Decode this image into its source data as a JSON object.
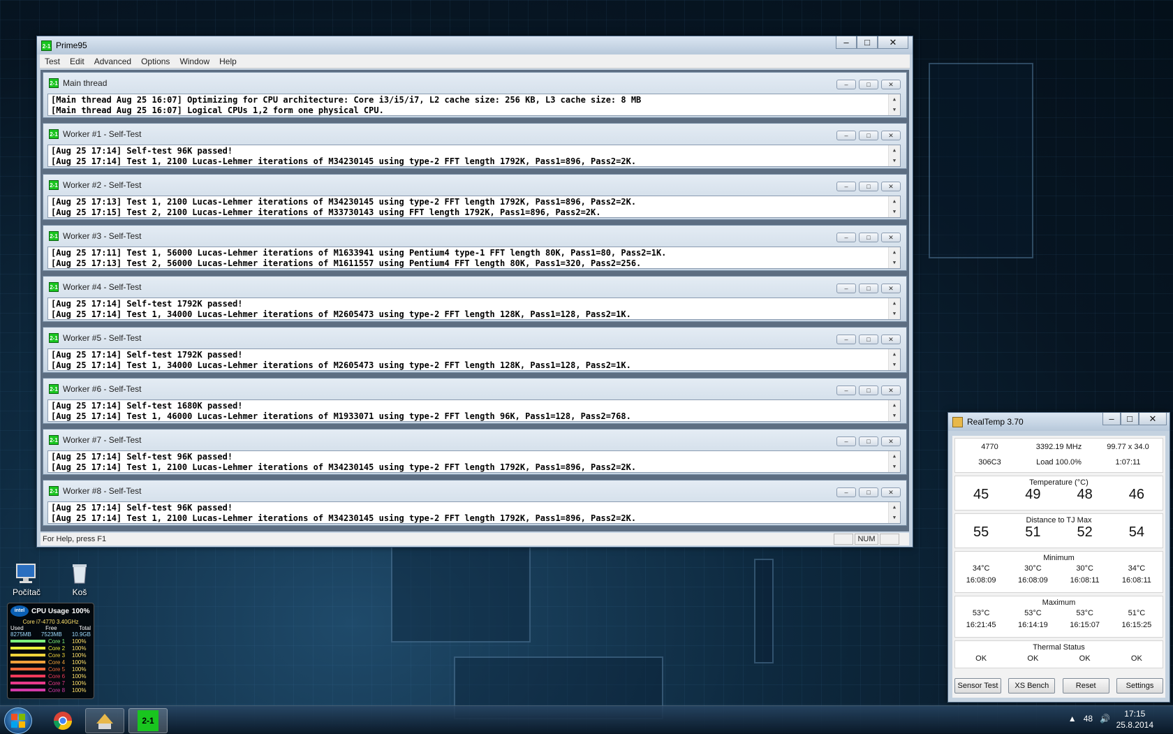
{
  "prime95": {
    "title": "Prime95",
    "menu": [
      "Test",
      "Edit",
      "Advanced",
      "Options",
      "Window",
      "Help"
    ],
    "threads": [
      {
        "title": "Main thread",
        "lines": [
          "[Main thread Aug 25 16:07] Optimizing for CPU architecture: Core i3/i5/i7, L2 cache size: 256 KB, L3 cache size: 8 MB",
          "[Main thread Aug 25 16:07] Logical CPUs 1,2 form one physical CPU."
        ]
      },
      {
        "title": "Worker #1 - Self-Test",
        "lines": [
          "[Aug 25 17:14] Self-test 96K passed!",
          "[Aug 25 17:14] Test 1, 2100 Lucas-Lehmer iterations of M34230145 using type-2 FFT length 1792K, Pass1=896, Pass2=2K."
        ]
      },
      {
        "title": "Worker #2 - Self-Test",
        "lines": [
          "[Aug 25 17:13] Test 1, 2100 Lucas-Lehmer iterations of M34230145 using type-2 FFT length 1792K, Pass1=896, Pass2=2K.",
          "[Aug 25 17:15] Test 2, 2100 Lucas-Lehmer iterations of M33730143 using FFT length 1792K, Pass1=896, Pass2=2K."
        ]
      },
      {
        "title": "Worker #3 - Self-Test",
        "lines": [
          "[Aug 25 17:11] Test 1, 56000 Lucas-Lehmer iterations of M1633941 using Pentium4 type-1 FFT length 80K, Pass1=80, Pass2=1K.",
          "[Aug 25 17:13] Test 2, 56000 Lucas-Lehmer iterations of M1611557 using Pentium4 FFT length 80K, Pass1=320, Pass2=256."
        ]
      },
      {
        "title": "Worker #4 - Self-Test",
        "lines": [
          "[Aug 25 17:14] Self-test 1792K passed!",
          "[Aug 25 17:14] Test 1, 34000 Lucas-Lehmer iterations of M2605473 using type-2 FFT length 128K, Pass1=128, Pass2=1K."
        ]
      },
      {
        "title": "Worker #5 - Self-Test",
        "lines": [
          "[Aug 25 17:14] Self-test 1792K passed!",
          "[Aug 25 17:14] Test 1, 34000 Lucas-Lehmer iterations of M2605473 using type-2 FFT length 128K, Pass1=128, Pass2=1K."
        ]
      },
      {
        "title": "Worker #6 - Self-Test",
        "lines": [
          "[Aug 25 17:14] Self-test 1680K passed!",
          "[Aug 25 17:14] Test 1, 46000 Lucas-Lehmer iterations of M1933071 using type-2 FFT length 96K, Pass1=128, Pass2=768."
        ]
      },
      {
        "title": "Worker #7 - Self-Test",
        "lines": [
          "[Aug 25 17:14] Self-test 96K passed!",
          "[Aug 25 17:14] Test 1, 2100 Lucas-Lehmer iterations of M34230145 using type-2 FFT length 1792K, Pass1=896, Pass2=2K."
        ]
      },
      {
        "title": "Worker #8 - Self-Test",
        "lines": [
          "[Aug 25 17:14] Self-test 96K passed!",
          "[Aug 25 17:14] Test 1, 2100 Lucas-Lehmer iterations of M34230145 using type-2 FFT length 1792K, Pass1=896, Pass2=2K."
        ]
      }
    ],
    "status": {
      "help": "For Help, press F1",
      "num": "NUM"
    }
  },
  "realtemp": {
    "title": "RealTemp 3.70",
    "cpu": {
      "model": "4770",
      "freq": "3392.19 MHz",
      "mult": "99.77 x 34.0",
      "id": "306C3",
      "load": "Load 100.0%",
      "time": "1:07:11"
    },
    "temperature": {
      "label": "Temperature (°C)",
      "values": [
        "45",
        "49",
        "48",
        "46"
      ]
    },
    "distance": {
      "label": "Distance to TJ Max",
      "values": [
        "55",
        "51",
        "52",
        "54"
      ]
    },
    "minimum": {
      "label": "Minimum",
      "temps": [
        "34°C",
        "30°C",
        "30°C",
        "34°C"
      ],
      "times": [
        "16:08:09",
        "16:08:09",
        "16:08:11",
        "16:08:11"
      ]
    },
    "maximum": {
      "label": "Maximum",
      "temps": [
        "53°C",
        "53°C",
        "53°C",
        "51°C"
      ],
      "times": [
        "16:21:45",
        "16:14:19",
        "16:15:07",
        "16:15:25"
      ]
    },
    "thermal": {
      "label": "Thermal Status",
      "values": [
        "OK",
        "OK",
        "OK",
        "OK"
      ]
    },
    "buttons": [
      "Sensor Test",
      "XS Bench",
      "Reset",
      "Settings"
    ]
  },
  "desktop": {
    "icons": [
      {
        "label": "Počítač",
        "icon": "computer-icon"
      },
      {
        "label": "Koš",
        "icon": "recycle-bin-icon"
      }
    ],
    "gadget": {
      "title": "CPU Usage",
      "total": "100%",
      "brand": "intel",
      "cpu": "Core i7-4770 3.40GHz",
      "headers": [
        "Used",
        "Free",
        "Total"
      ],
      "mem": [
        "8275MB",
        "7523MB",
        "10.9GB"
      ],
      "cores": [
        {
          "name": "Core 1",
          "value": "100%",
          "color": "#7cf07c"
        },
        {
          "name": "Core 2",
          "value": "100%",
          "color": "#e8f03a"
        },
        {
          "name": "Core 3",
          "value": "100%",
          "color": "#f0d23a"
        },
        {
          "name": "Core 4",
          "value": "100%",
          "color": "#f0a03a"
        },
        {
          "name": "Core 5",
          "value": "100%",
          "color": "#f06a3a"
        },
        {
          "name": "Core 6",
          "value": "100%",
          "color": "#f03a5a"
        },
        {
          "name": "Core 7",
          "value": "100%",
          "color": "#e83a8a"
        },
        {
          "name": "Core 8",
          "value": "100%",
          "color": "#d43aa8"
        }
      ]
    }
  },
  "taskbar": {
    "tray_temp": "48",
    "time": "17:15",
    "date": "25.8.2014"
  }
}
